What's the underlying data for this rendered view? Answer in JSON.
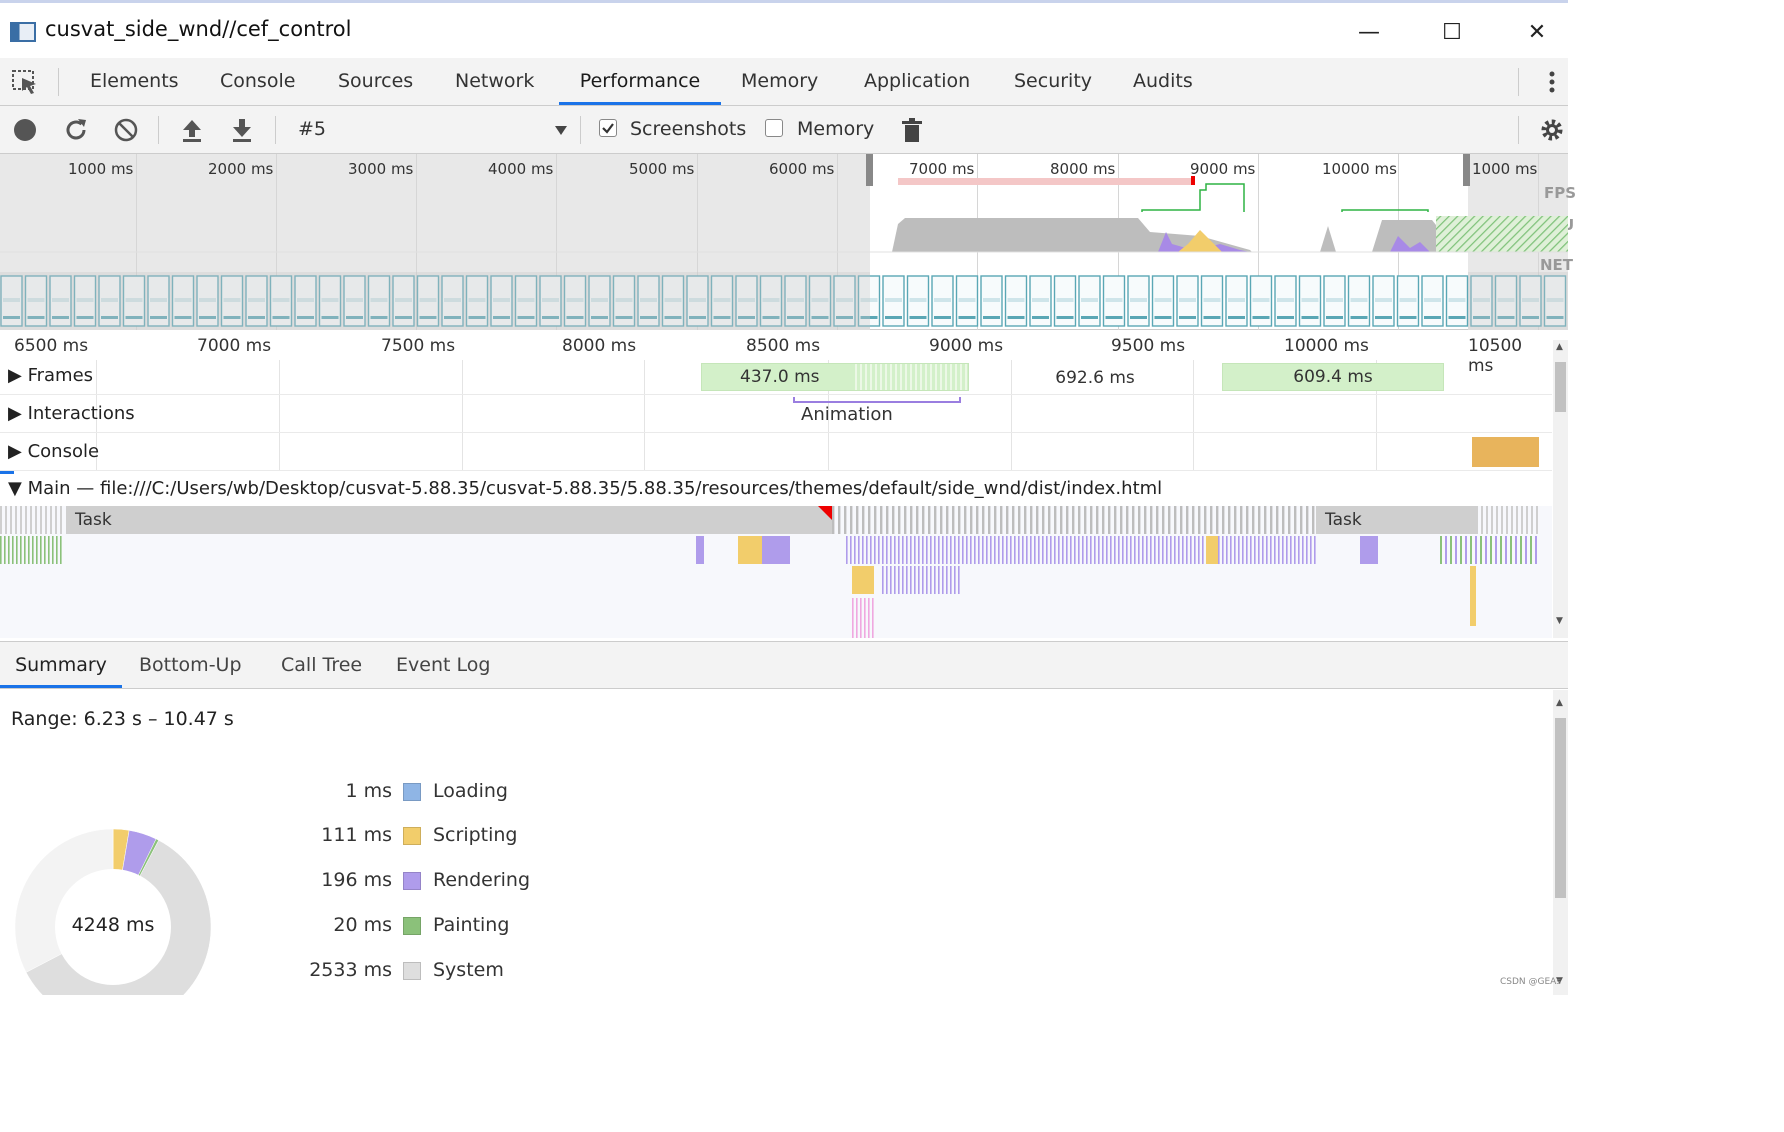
{
  "window": {
    "title": "cusvat_side_wnd//cef_control",
    "minimize": "—",
    "maximize": "☐",
    "close": "✕"
  },
  "tabs": [
    {
      "label": "Elements"
    },
    {
      "label": "Console"
    },
    {
      "label": "Sources"
    },
    {
      "label": "Network"
    },
    {
      "label": "Performance",
      "active": true
    },
    {
      "label": "Memory"
    },
    {
      "label": "Application"
    },
    {
      "label": "Security"
    },
    {
      "label": "Audits"
    }
  ],
  "toolbar": {
    "recording_select": "#5",
    "screenshots_label": "Screenshots",
    "screenshots_checked": true,
    "memory_label": "Memory",
    "memory_checked": false,
    "icons": [
      "record-icon",
      "reload-icon",
      "clear-icon",
      "upload-icon",
      "download-icon",
      "trash-icon",
      "gear-icon"
    ]
  },
  "overview": {
    "ticks": [
      "1000 ms",
      "2000 ms",
      "3000 ms",
      "4000 ms",
      "5000 ms",
      "6000 ms",
      "7000 ms",
      "8000 ms",
      "9000 ms",
      "10000 ms",
      "1000 ms"
    ],
    "lanes": [
      "FPS",
      "CPU",
      "NET"
    ]
  },
  "timeline": {
    "ruler": [
      "6500 ms",
      "7000 ms",
      "7500 ms",
      "8000 ms",
      "8500 ms",
      "9000 ms",
      "9500 ms",
      "10000 ms",
      "10500 ms"
    ],
    "tracks": {
      "frames": "Frames",
      "interactions": "Interactions",
      "console": "Console",
      "main": "Main — file:///C:/Users/wb/Desktop/cusvat-5.88.35/cusvat-5.88.35/5.88.35/resources/themes/default/side_wnd/dist/index.html"
    },
    "frames": [
      "437.0 ms",
      "692.6 ms",
      "609.4 ms"
    ],
    "animation_label": "Animation",
    "task_labels": [
      "Task",
      "Task"
    ]
  },
  "bottom_tabs": [
    {
      "label": "Summary",
      "active": true
    },
    {
      "label": "Bottom-Up"
    },
    {
      "label": "Call Tree"
    },
    {
      "label": "Event Log"
    }
  ],
  "summary": {
    "range": "Range: 6.23 s – 10.47 s",
    "total": "4248 ms",
    "legend": [
      {
        "value": "1 ms",
        "name": "Loading",
        "color": "#8fb5e5",
        "ms": 1
      },
      {
        "value": "111 ms",
        "name": "Scripting",
        "color": "#f2cd6b",
        "ms": 111
      },
      {
        "value": "196 ms",
        "name": "Rendering",
        "color": "#af9ceb",
        "ms": 196
      },
      {
        "value": "20 ms",
        "name": "Painting",
        "color": "#8bc17a",
        "ms": 20
      },
      {
        "value": "2533 ms",
        "name": "System",
        "color": "#dedede",
        "ms": 2533
      }
    ],
    "idle_color": "#f3f3f3"
  },
  "watermark": "CSDN @GEAs"
}
